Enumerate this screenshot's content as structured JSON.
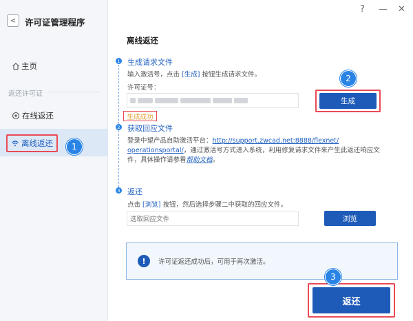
{
  "window": {
    "help": "?",
    "minimize": "—",
    "close": "✕"
  },
  "sidebar": {
    "back": "<",
    "title": "许可证管理程序",
    "home": "主页",
    "section": "返还许可证",
    "online": "在线返还",
    "offline": "离线返还"
  },
  "badges": {
    "b1": "1",
    "b2": "2",
    "b3": "3"
  },
  "main": {
    "title": "离线返还",
    "step1": {
      "num": "1",
      "title": "生成请求文件",
      "desc_prefix": "输入激活号，点击 ",
      "desc_bracket": "[生成]",
      "desc_suffix": " 按钮生成请求文件。",
      "license_label": "许可证号：",
      "generate": "生成",
      "success": "生成成功"
    },
    "step2": {
      "num": "2",
      "title": "获取回应文件",
      "line1_prefix": "登录中望产品自助激活平台：",
      "link_part1": "http://support.zwcad.net:8888/flexnet/",
      "link_part2": "operationsportal/",
      "line2_suffix": "，通过激活号方式进入系统，利用修复请求文件来产生此返还响应文",
      "line3_prefix": "件，具体操作请参看",
      "help_link": "帮助文档",
      "line3_suffix": "。"
    },
    "step3": {
      "num": "3",
      "title": "返还",
      "desc_prefix": "点击 ",
      "desc_bracket": "[浏览]",
      "desc_suffix": " 按钮，然后选择步骤二中获取的回应文件。",
      "placeholder": "选取回应文件",
      "browse": "浏览"
    },
    "notice": {
      "icon": "!",
      "text": "许可证返还成功后，可用于再次激活。"
    },
    "return_button": "返还"
  },
  "colors": {
    "primary": "#1e5bb8",
    "accent": "#2a84e6",
    "highlight": "#e84a55",
    "success": "#e6a23c"
  }
}
